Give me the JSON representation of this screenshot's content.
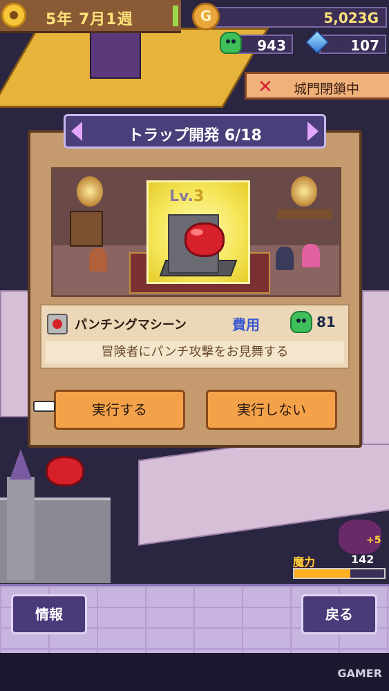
{
  "hud": {
    "date": "5年 7月1週",
    "gold": "5,023G",
    "slime_count": "943",
    "crystal_count": "107",
    "gate_status": "城門閉鎖中"
  },
  "dialog": {
    "title": "トラップ開発 6/18",
    "level_prefix": "Lv.",
    "level_value": "3",
    "trap_name": "パンチングマシーン",
    "cost_label": "費用",
    "cost_value": "81",
    "description": "冒険者にパンチ攻撃をお見舞する",
    "confirm_label": "実行する",
    "cancel_label": "実行しない"
  },
  "status": {
    "mana_label": "魔力",
    "mana_value": "142",
    "mana_delta": "+5",
    "mana_fill_pct": 62
  },
  "bottom": {
    "info_label": "情報",
    "back_label": "戻る"
  },
  "watermark": "GAMER",
  "colors": {
    "gold_text": "#ffe27a",
    "title_bg": "#4a3f7a",
    "button_bg": "#f4a24a",
    "cost_label": "#3a5ad0"
  }
}
